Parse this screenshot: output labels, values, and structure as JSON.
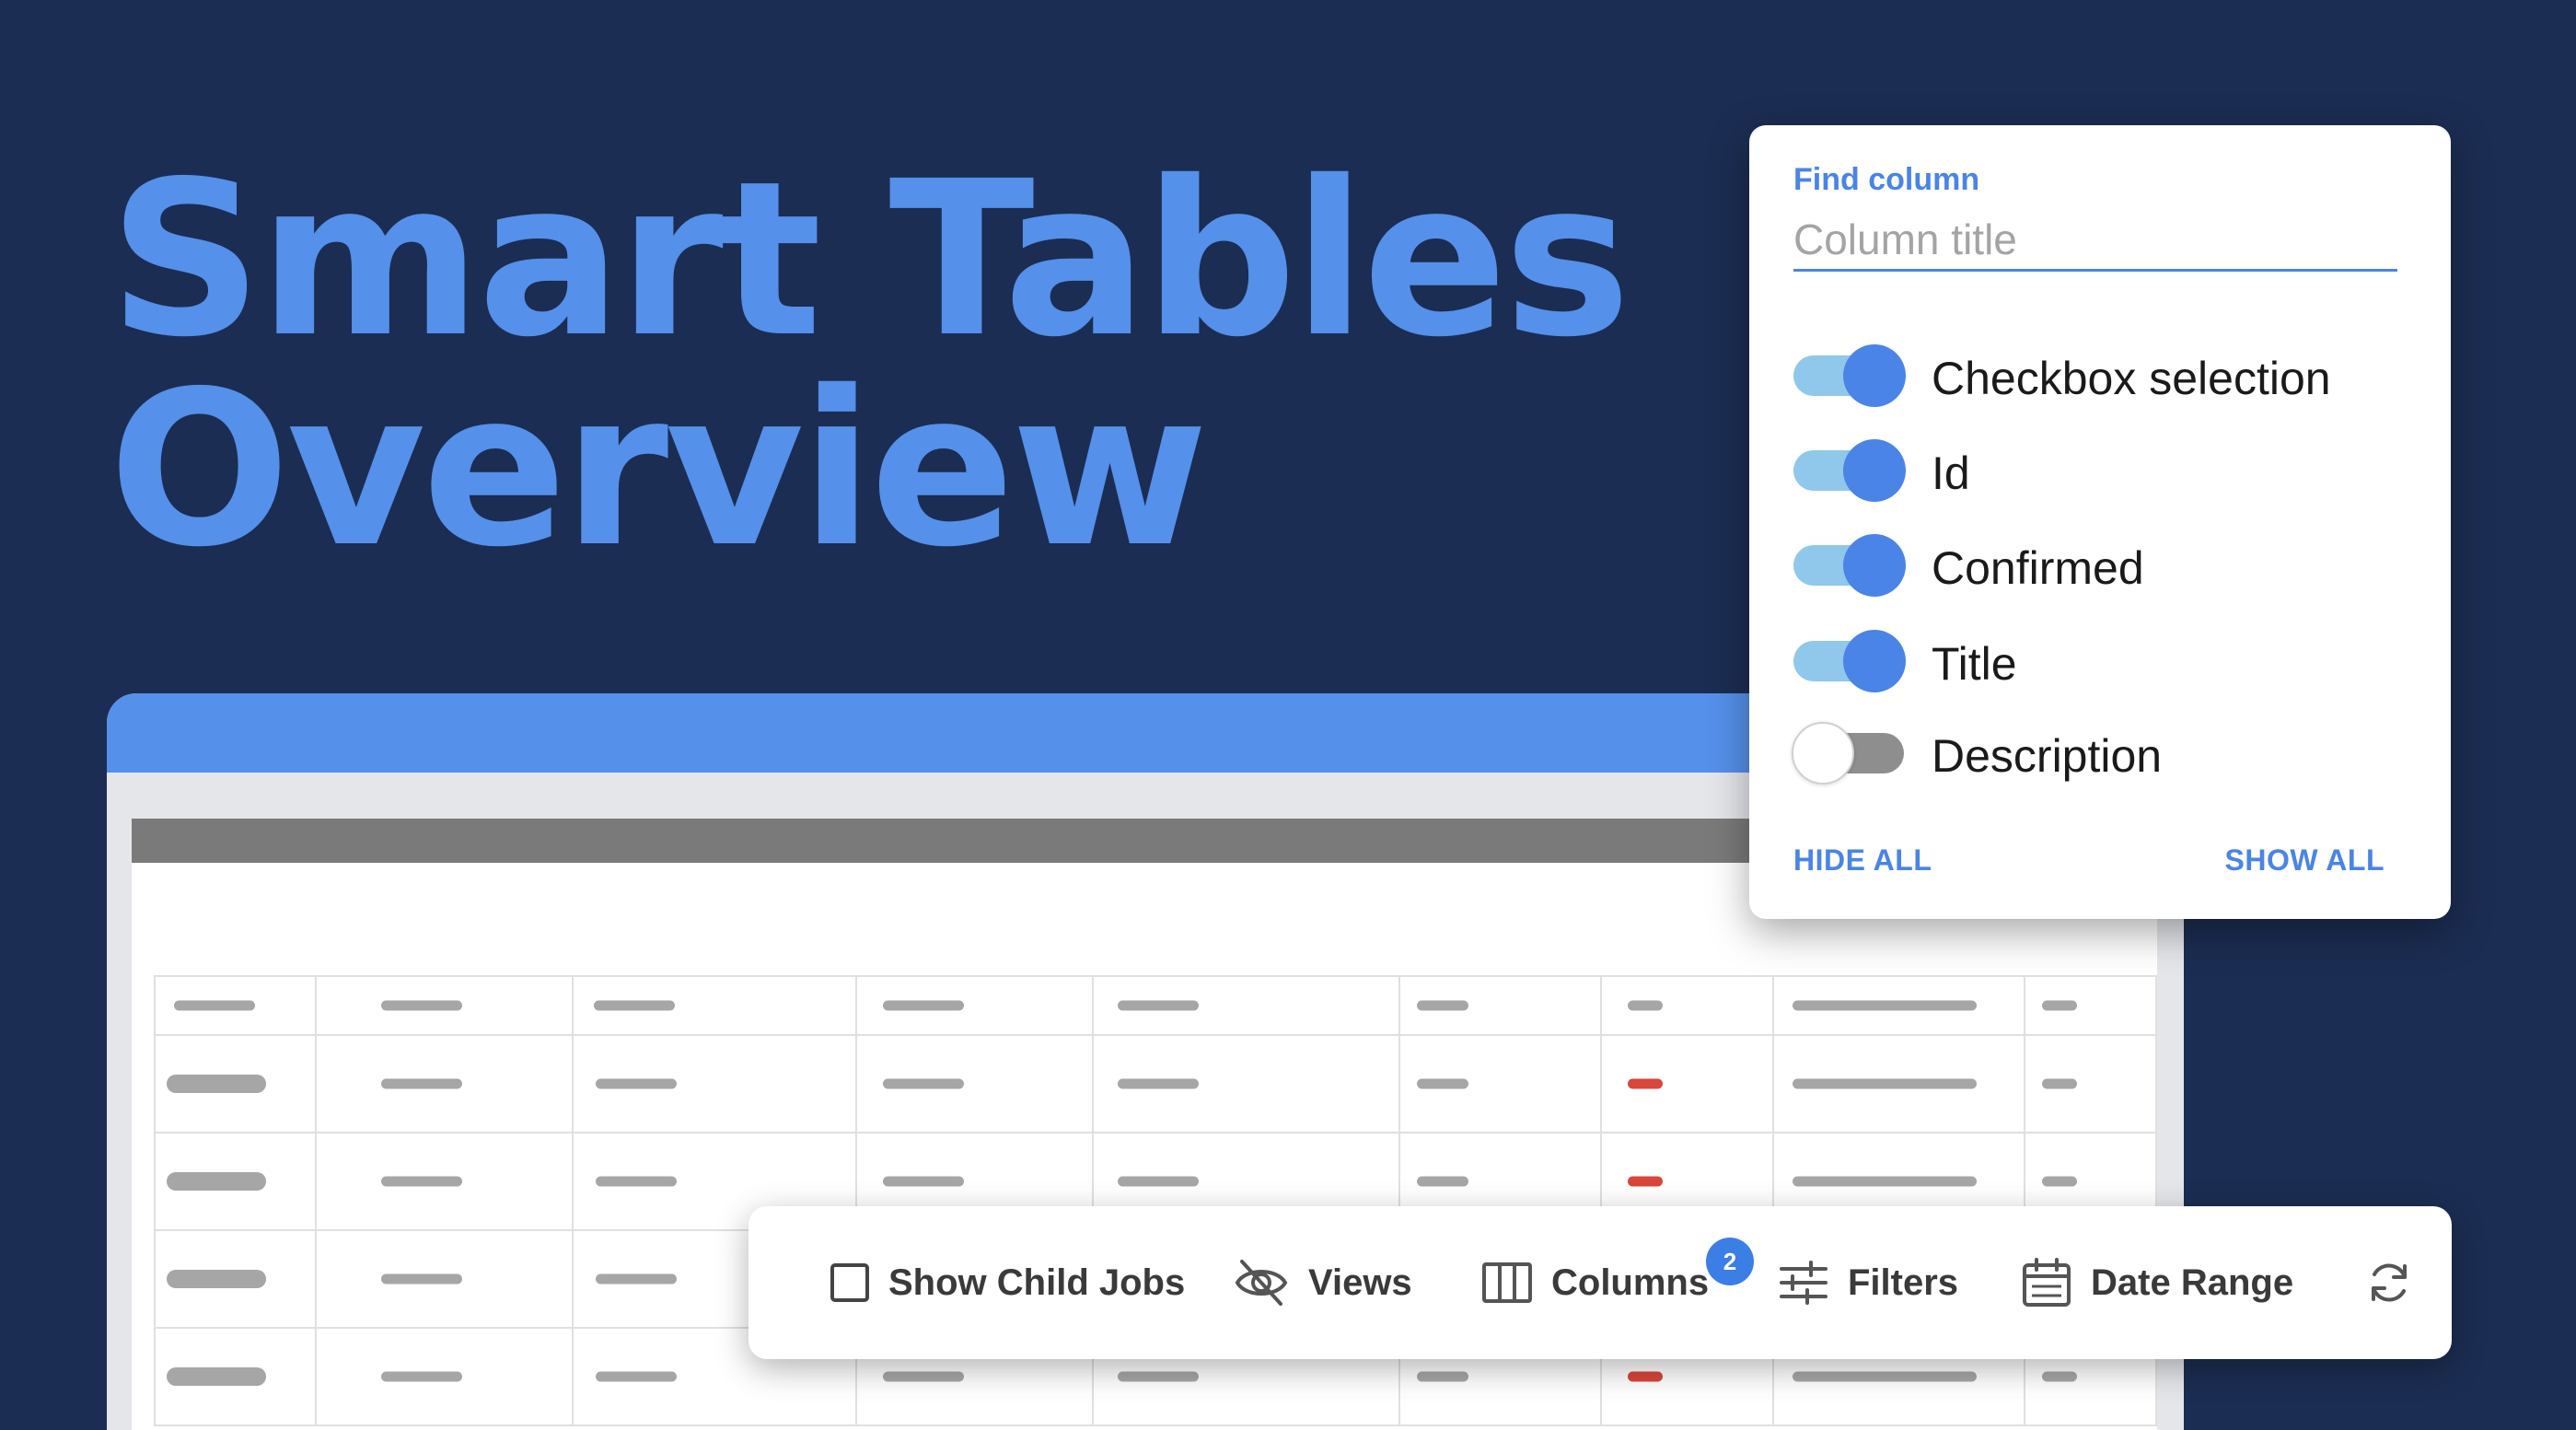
{
  "hero": {
    "line1": "Smart Tables",
    "line2": "Overview"
  },
  "column_panel": {
    "find_label": "Find column",
    "search_placeholder": "Column title",
    "columns": [
      {
        "label": "Checkbox selection",
        "enabled": true
      },
      {
        "label": "Id",
        "enabled": true
      },
      {
        "label": "Confirmed",
        "enabled": true
      },
      {
        "label": "Title",
        "enabled": true
      },
      {
        "label": "Description",
        "enabled": false
      }
    ],
    "hide_all": "HIDE ALL",
    "show_all": "SHOW ALL"
  },
  "toolbar": {
    "show_child_jobs": "Show Child Jobs",
    "views": "Views",
    "columns": "Columns",
    "filters": "Filters",
    "filters_badge": "2",
    "date_range": "Date Range"
  },
  "colors": {
    "background": "#1b2d52",
    "accent": "#5590ea",
    "toggle_track_on": "#8fc8ea",
    "status_red": "#d9463b"
  },
  "icons": {
    "views": "eye-off-icon",
    "columns": "columns-icon",
    "filters": "sliders-icon",
    "date_range": "calendar-icon",
    "refresh": "refresh-icon"
  }
}
